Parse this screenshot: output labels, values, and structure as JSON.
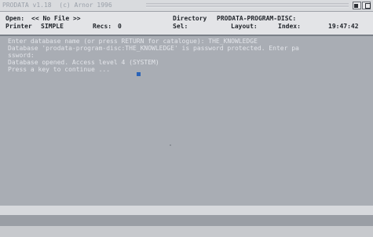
{
  "window": {
    "title": "PRODATA v1.18  (c) Arnor 1996"
  },
  "status": {
    "open_label": "Open:",
    "open_value": "<< No File >>",
    "printer_label": "Printer",
    "printer_value": "SIMPLE",
    "recs_label": "Recs:",
    "recs_value": "0",
    "directory_label": "Directory",
    "directory_value": "PRODATA-PROGRAM-DISC:",
    "sel_label": "Sel:",
    "sel_value": "",
    "layout_label": "Layout:",
    "layout_value": "",
    "index_label": "Index:",
    "index_value": "",
    "clock": "19:47:42"
  },
  "console": {
    "lines": [
      "Enter database name (or press RETURN for catalogue): THE_KNOWLEDGE",
      "Database 'prodata-program-disc:THE_KNOWLEDGE' is password protected. Enter pa",
      "ssword:",
      "Database opened. Access level 4 (SYSTEM)",
      "Press a key to continue ..."
    ]
  },
  "colors": {
    "background": "#a9adb4",
    "status_bar": "#e3e4e7",
    "console_text": "#e3e5ea",
    "cursor": "#2a63b8"
  }
}
